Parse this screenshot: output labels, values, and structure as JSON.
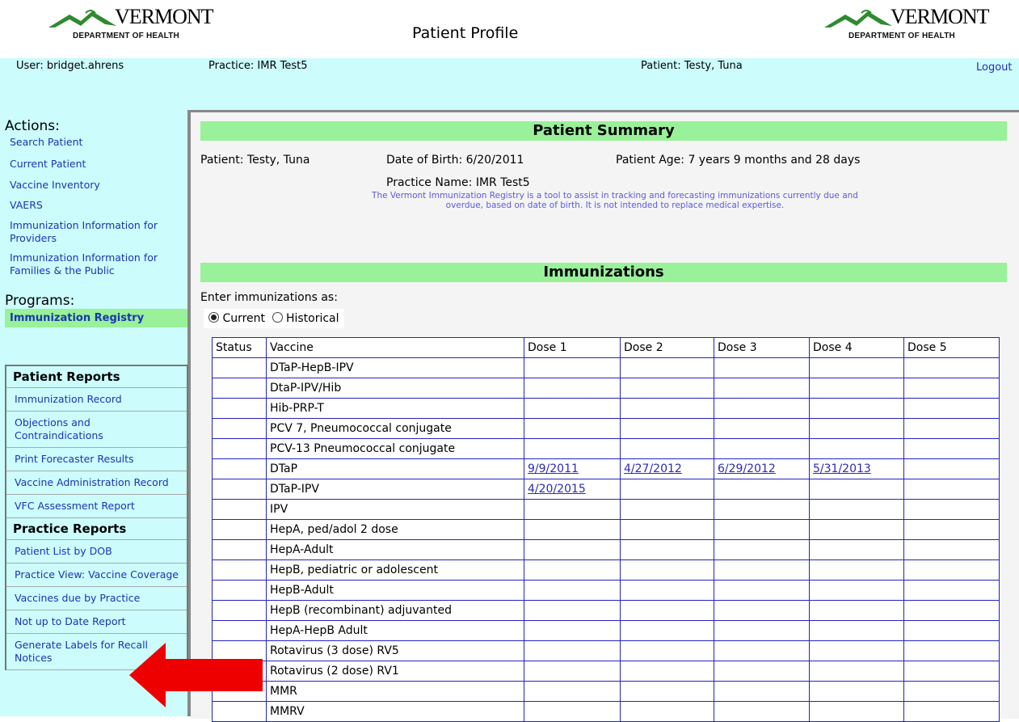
{
  "header": {
    "brand": "VERMONT",
    "dept": "DEPARTMENT OF HEALTH",
    "title": "Patient Profile"
  },
  "infobar": {
    "user": "User: bridget.ahrens",
    "practice": "Practice: IMR Test5",
    "patient": "Patient: Testy, Tuna",
    "logout": "Logout"
  },
  "sidebar": {
    "actions_title": "Actions:",
    "actions": [
      "Search Patient",
      "Current Patient",
      "Vaccine Inventory",
      "VAERS",
      "Immunization Information for Providers",
      "Immunization Information for Families & the Public"
    ],
    "programs_title": "Programs:",
    "program_selected": "Immunization Registry",
    "patient_reports_title": "Patient Reports",
    "patient_reports": [
      "Immunization Record",
      "Objections and Contraindications",
      "Print Forecaster Results",
      "Vaccine Administration Record",
      "VFC Assessment Report"
    ],
    "practice_reports_title": "Practice Reports",
    "practice_reports": [
      "Patient List by DOB",
      "Practice View: Vaccine Coverage",
      "Vaccines due by Practice",
      "Not up to Date Report",
      "Generate Labels for Recall Notices"
    ]
  },
  "summary": {
    "title": "Patient Summary",
    "patient": "Patient: Testy, Tuna",
    "dob": "Date of Birth: 6/20/2011",
    "age": "Patient Age: 7 years 9 months and 28 days",
    "practice_name": "Practice Name: IMR Test5",
    "notice_line1": "The Vermont Immunization Registry is a tool to assist in tracking and forecasting immunizations currently due and",
    "notice_line2": "overdue, based on date of birth. It is not intended to replace medical expertise."
  },
  "immunizations": {
    "title": "Immunizations",
    "enter_as": "Enter immunizations as:",
    "mode_current": "Current",
    "mode_historical": "Historical",
    "selected_mode": "Current",
    "columns": [
      "Status",
      "Vaccine",
      "Dose 1",
      "Dose 2",
      "Dose 3",
      "Dose 4",
      "Dose 5"
    ],
    "rows": [
      {
        "vaccine": "DTaP-HepB-IPV",
        "doses": [
          "",
          "",
          "",
          "",
          ""
        ]
      },
      {
        "vaccine": "DtaP-IPV/Hib",
        "doses": [
          "",
          "",
          "",
          "",
          ""
        ]
      },
      {
        "vaccine": "Hib-PRP-T",
        "doses": [
          "",
          "",
          "",
          "",
          ""
        ]
      },
      {
        "vaccine": "PCV 7, Pneumococcal conjugate",
        "doses": [
          "",
          "",
          "",
          "",
          ""
        ]
      },
      {
        "vaccine": "PCV-13 Pneumococcal conjugate",
        "doses": [
          "",
          "",
          "",
          "",
          ""
        ]
      },
      {
        "vaccine": "DTaP",
        "doses": [
          "9/9/2011",
          "4/27/2012",
          "6/29/2012",
          "5/31/2013",
          ""
        ]
      },
      {
        "vaccine": "DTaP-IPV",
        "doses": [
          "4/20/2015",
          "",
          "",
          "",
          ""
        ]
      },
      {
        "vaccine": "IPV",
        "doses": [
          "",
          "",
          "",
          "",
          ""
        ]
      },
      {
        "vaccine": "HepA, ped/adol 2 dose",
        "doses": [
          "",
          "",
          "",
          "",
          ""
        ]
      },
      {
        "vaccine": "HepA-Adult",
        "doses": [
          "",
          "",
          "",
          "",
          ""
        ]
      },
      {
        "vaccine": "HepB, pediatric or adolescent",
        "doses": [
          "",
          "",
          "",
          "",
          ""
        ]
      },
      {
        "vaccine": "HepB-Adult",
        "doses": [
          "",
          "",
          "",
          "",
          ""
        ]
      },
      {
        "vaccine": "HepB (recombinant) adjuvanted",
        "doses": [
          "",
          "",
          "",
          "",
          ""
        ]
      },
      {
        "vaccine": "HepA-HepB Adult",
        "doses": [
          "",
          "",
          "",
          "",
          ""
        ]
      },
      {
        "vaccine": "Rotavirus (3 dose) RV5",
        "doses": [
          "",
          "",
          "",
          "",
          ""
        ]
      },
      {
        "vaccine": "Rotavirus (2 dose) RV1",
        "doses": [
          "",
          "",
          "",
          "",
          ""
        ]
      },
      {
        "vaccine": "MMR",
        "doses": [
          "",
          "",
          "",
          "",
          ""
        ]
      },
      {
        "vaccine": "MMRV",
        "doses": [
          "",
          "",
          "",
          "",
          ""
        ]
      }
    ]
  },
  "colors": {
    "infobar_bg": "#ccfcfc",
    "section_bar": "#99f199",
    "link": "#1a35b5",
    "table_border": "#2424c0",
    "arrow": "#ee0000"
  }
}
